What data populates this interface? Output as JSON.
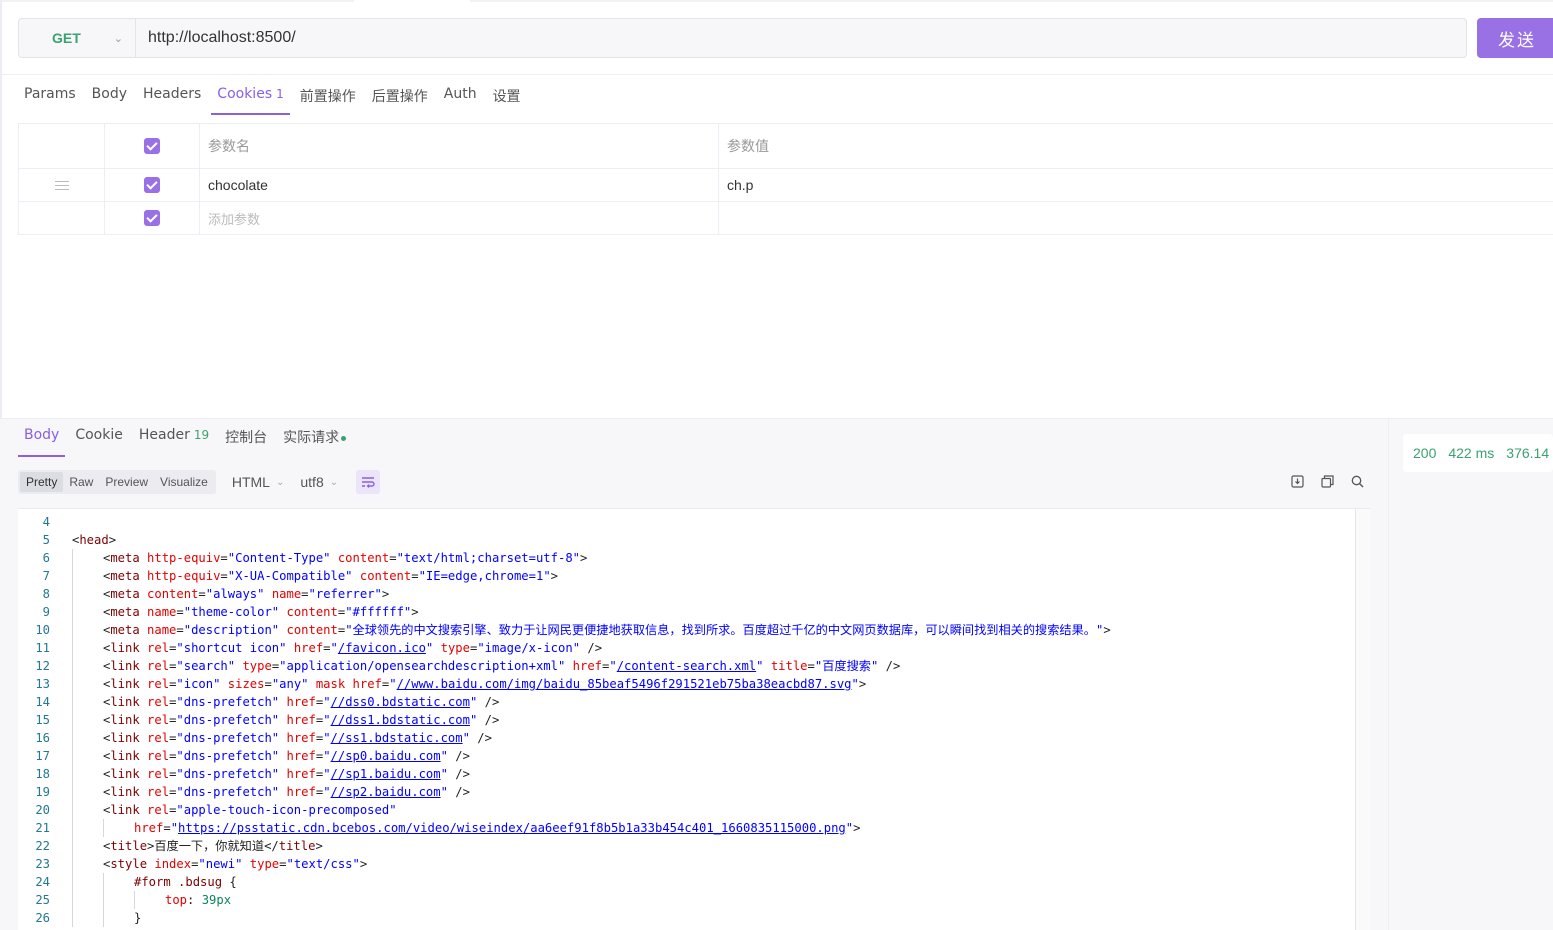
{
  "request": {
    "method": "GET",
    "url": "http://localhost:8500/",
    "send_label": "发送"
  },
  "request_tabs": [
    {
      "label": "Params"
    },
    {
      "label": "Body"
    },
    {
      "label": "Headers"
    },
    {
      "label": "Cookies",
      "count": "1",
      "active": true
    },
    {
      "label": "前置操作"
    },
    {
      "label": "后置操作"
    },
    {
      "label": "Auth"
    },
    {
      "label": "设置"
    }
  ],
  "params_table": {
    "header_name": "参数名",
    "header_value": "参数值",
    "rows": [
      {
        "name": "chocolate",
        "value": "ch.p",
        "checked": true
      }
    ],
    "add_placeholder": "添加参数"
  },
  "response_tabs": [
    {
      "label": "Body",
      "active": true
    },
    {
      "label": "Cookie"
    },
    {
      "label": "Header",
      "count": "19"
    },
    {
      "label": "控制台"
    },
    {
      "label": "实际请求",
      "dot": true
    }
  ],
  "format": {
    "modes": [
      "Pretty",
      "Raw",
      "Preview",
      "Visualize"
    ],
    "active_mode": "Pretty",
    "language": "HTML",
    "encoding": "utf8"
  },
  "status": {
    "code": "200",
    "time": "422 ms",
    "size": "376.14"
  },
  "icons": {
    "method_dropdown": "chevron-down-icon",
    "drag": "drag-handle-icon",
    "wrap": "wrap-text-icon",
    "download": "download-icon",
    "copy": "copy-icon",
    "search": "search-icon"
  },
  "colors": {
    "accent": "#8a5fe0",
    "send_button": "#9a70e5",
    "method_get": "#3aa272",
    "status": "#3aa272"
  },
  "code_lines": [
    {
      "n": "4",
      "indent": 0,
      "html": ""
    },
    {
      "n": "5",
      "indent": 0,
      "html": "<span class='b'>&lt;</span><span class='t'>head</span><span class='b'>&gt;</span>"
    },
    {
      "n": "6",
      "indent": 1,
      "html": "<span class='b'>&lt;</span><span class='t'>meta</span> <span class='a'>http-equiv</span><span class='b'>=</span><span class='v'>\"Content-Type\"</span> <span class='a'>content</span><span class='b'>=</span><span class='v'>\"text/html;charset=utf-8\"</span><span class='b'>&gt;</span>"
    },
    {
      "n": "7",
      "indent": 1,
      "html": "<span class='b'>&lt;</span><span class='t'>meta</span> <span class='a'>http-equiv</span><span class='b'>=</span><span class='v'>\"X-UA-Compatible\"</span> <span class='a'>content</span><span class='b'>=</span><span class='v'>\"IE=edge,chrome=1\"</span><span class='b'>&gt;</span>"
    },
    {
      "n": "8",
      "indent": 1,
      "html": "<span class='b'>&lt;</span><span class='t'>meta</span> <span class='a'>content</span><span class='b'>=</span><span class='v'>\"always\"</span> <span class='a'>name</span><span class='b'>=</span><span class='v'>\"referrer\"</span><span class='b'>&gt;</span>"
    },
    {
      "n": "9",
      "indent": 1,
      "html": "<span class='b'>&lt;</span><span class='t'>meta</span> <span class='a'>name</span><span class='b'>=</span><span class='v'>\"theme-color\"</span> <span class='a'>content</span><span class='b'>=</span><span class='v'>\"#ffffff\"</span><span class='b'>&gt;</span>"
    },
    {
      "n": "10",
      "indent": 1,
      "html": "<span class='b'>&lt;</span><span class='t'>meta</span> <span class='a'>name</span><span class='b'>=</span><span class='v'>\"description\"</span> <span class='a'>content</span><span class='b'>=</span><span class='v'>\"全球领先的中文搜索引擎、致力于让网民更便捷地获取信息，找到所求。百度超过千亿的中文网页数据库，可以瞬间找到相关的搜索结果。\"</span><span class='b'>&gt;</span>"
    },
    {
      "n": "11",
      "indent": 1,
      "html": "<span class='b'>&lt;</span><span class='t'>link</span> <span class='a'>rel</span><span class='b'>=</span><span class='v'>\"shortcut icon\"</span> <span class='a'>href</span><span class='b'>=</span><span class='v'>\"</span><span class='u'>/favicon.ico</span><span class='v'>\"</span> <span class='a'>type</span><span class='b'>=</span><span class='v'>\"image/x-icon\"</span> <span class='b'>/&gt;</span>"
    },
    {
      "n": "12",
      "indent": 1,
      "html": "<span class='b'>&lt;</span><span class='t'>link</span> <span class='a'>rel</span><span class='b'>=</span><span class='v'>\"search\"</span> <span class='a'>type</span><span class='b'>=</span><span class='v'>\"application/opensearchdescription+xml\"</span> <span class='a'>href</span><span class='b'>=</span><span class='v'>\"</span><span class='u'>/content-search.xml</span><span class='v'>\"</span> <span class='a'>title</span><span class='b'>=</span><span class='v'>\"百度搜索\"</span> <span class='b'>/&gt;</span>"
    },
    {
      "n": "13",
      "indent": 1,
      "html": "<span class='b'>&lt;</span><span class='t'>link</span> <span class='a'>rel</span><span class='b'>=</span><span class='v'>\"icon\"</span> <span class='a'>sizes</span><span class='b'>=</span><span class='v'>\"any\"</span> <span class='a'>mask</span> <span class='a'>href</span><span class='b'>=</span><span class='v'>\"</span><span class='u'>//www.baidu.com/img/baidu_85beaf5496f291521eb75ba38eacbd87.svg</span><span class='v'>\"</span><span class='b'>&gt;</span>"
    },
    {
      "n": "14",
      "indent": 1,
      "html": "<span class='b'>&lt;</span><span class='t'>link</span> <span class='a'>rel</span><span class='b'>=</span><span class='v'>\"dns-prefetch\"</span> <span class='a'>href</span><span class='b'>=</span><span class='v'>\"</span><span class='u'>//dss0.bdstatic.com</span><span class='v'>\"</span> <span class='b'>/&gt;</span>"
    },
    {
      "n": "15",
      "indent": 1,
      "html": "<span class='b'>&lt;</span><span class='t'>link</span> <span class='a'>rel</span><span class='b'>=</span><span class='v'>\"dns-prefetch\"</span> <span class='a'>href</span><span class='b'>=</span><span class='v'>\"</span><span class='u'>//dss1.bdstatic.com</span><span class='v'>\"</span> <span class='b'>/&gt;</span>"
    },
    {
      "n": "16",
      "indent": 1,
      "html": "<span class='b'>&lt;</span><span class='t'>link</span> <span class='a'>rel</span><span class='b'>=</span><span class='v'>\"dns-prefetch\"</span> <span class='a'>href</span><span class='b'>=</span><span class='v'>\"</span><span class='u'>//ss1.bdstatic.com</span><span class='v'>\"</span> <span class='b'>/&gt;</span>"
    },
    {
      "n": "17",
      "indent": 1,
      "html": "<span class='b'>&lt;</span><span class='t'>link</span> <span class='a'>rel</span><span class='b'>=</span><span class='v'>\"dns-prefetch\"</span> <span class='a'>href</span><span class='b'>=</span><span class='v'>\"</span><span class='u'>//sp0.baidu.com</span><span class='v'>\"</span> <span class='b'>/&gt;</span>"
    },
    {
      "n": "18",
      "indent": 1,
      "html": "<span class='b'>&lt;</span><span class='t'>link</span> <span class='a'>rel</span><span class='b'>=</span><span class='v'>\"dns-prefetch\"</span> <span class='a'>href</span><span class='b'>=</span><span class='v'>\"</span><span class='u'>//sp1.baidu.com</span><span class='v'>\"</span> <span class='b'>/&gt;</span>"
    },
    {
      "n": "19",
      "indent": 1,
      "html": "<span class='b'>&lt;</span><span class='t'>link</span> <span class='a'>rel</span><span class='b'>=</span><span class='v'>\"dns-prefetch\"</span> <span class='a'>href</span><span class='b'>=</span><span class='v'>\"</span><span class='u'>//sp2.baidu.com</span><span class='v'>\"</span> <span class='b'>/&gt;</span>"
    },
    {
      "n": "20",
      "indent": 1,
      "html": "<span class='b'>&lt;</span><span class='t'>link</span> <span class='a'>rel</span><span class='b'>=</span><span class='v'>\"apple-touch-icon-precomposed\"</span>"
    },
    {
      "n": "21",
      "indent": 2,
      "html": "<span class='a'>href</span><span class='b'>=</span><span class='v'>\"</span><span class='u'>https://psstatic.cdn.bcebos.com/video/wiseindex/aa6eef91f8b5b1a33b454c401_1660835115000.png</span><span class='v'>\"</span><span class='b'>&gt;</span>"
    },
    {
      "n": "22",
      "indent": 1,
      "html": "<span class='b'>&lt;</span><span class='t'>title</span><span class='b'>&gt;</span><span class='b'>百度一下，你就知道</span><span class='b'>&lt;/</span><span class='t'>title</span><span class='b'>&gt;</span>"
    },
    {
      "n": "23",
      "indent": 1,
      "html": "<span class='b'>&lt;</span><span class='t'>style</span> <span class='a'>index</span><span class='b'>=</span><span class='v'>\"newi\"</span> <span class='a'>type</span><span class='b'>=</span><span class='v'>\"text/css\"</span><span class='b'>&gt;</span>"
    },
    {
      "n": "24",
      "indent": 2,
      "html": "<span class='s'>#form .bdsug</span> <span class='b'>{</span>"
    },
    {
      "n": "25",
      "indent": 3,
      "html": "<span class='p'>top</span><span class='b'>:</span> <span class='n'>39px</span>"
    },
    {
      "n": "26",
      "indent": 2,
      "html": "<span class='b'>}</span>"
    }
  ]
}
